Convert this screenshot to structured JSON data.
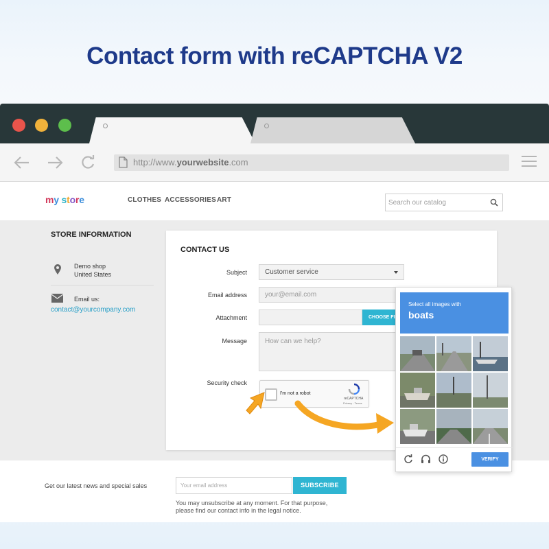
{
  "hero": {
    "title": "Contact form with reCAPTCHA V2"
  },
  "browser": {
    "url_prefix": "http://www.",
    "url_domain": "yourwebsite",
    "url_suffix": ".com"
  },
  "site": {
    "logo": {
      "word1": "my",
      "word2": "store"
    },
    "nav": [
      "CLOTHES",
      "ACCESSORIES",
      "ART"
    ],
    "search_placeholder": "Search our catalog"
  },
  "store_info": {
    "heading": "STORE INFORMATION",
    "address_line1": "Demo shop",
    "address_line2": "United States",
    "email_label": "Email us:",
    "email": "contact@yourcompany.com"
  },
  "contact": {
    "heading": "CONTACT US",
    "subject_label": "Subject",
    "subject_value": "Customer service",
    "email_label": "Email address",
    "email_placeholder": "your@email.com",
    "attachment_label": "Attachment",
    "choose_file": "CHOOSE FILE",
    "message_label": "Message",
    "message_placeholder": "How can we help?",
    "security_label": "Security check",
    "recaptcha_text": "I'm not a robot",
    "recaptcha_brand": "reCAPTCHA",
    "recaptcha_terms": "Privacy - Terms"
  },
  "newsletter": {
    "label": "Get our latest news and special sales",
    "placeholder": "Your email address",
    "button": "SUBSCRIBE",
    "note": "You may unsubscribe at any moment. For that purpose, please find our contact info in the legal notice."
  },
  "captcha_popup": {
    "instruction": "Select all images with",
    "target": "boats",
    "verify": "VERIFY",
    "icons": [
      "reload-icon",
      "audio-icon",
      "info-icon"
    ]
  },
  "colors": {
    "hero_title": "#1e3a8a",
    "accent": "#2fb5d2",
    "captcha_blue": "#4a90e2",
    "arrow": "#f5a623"
  }
}
